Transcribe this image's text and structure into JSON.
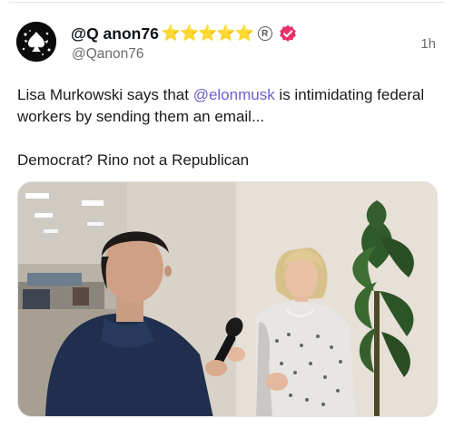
{
  "post": {
    "display_name": "@Q anon76",
    "name_decoration": "⭐⭐⭐⭐⭐",
    "registered_mark": "R",
    "handle": "@Qanon76",
    "timestamp": "1h",
    "text": {
      "line1_before": "Lisa Murkowski says that ",
      "mention": "@elonmusk",
      "line1_after": " is intimidating federal workers by sending them an email...",
      "line2": "Democrat? Rino not a Republican"
    },
    "media": {
      "icon": "video-thumbnail"
    }
  },
  "icons": {
    "avatar": "spade-splash-avatar-icon",
    "verified": "verified-badge-icon"
  },
  "colors": {
    "mention": "#6a5fcf",
    "verified": "#e8326a",
    "stars": "#f7c325",
    "secondary_text": "#6b6b6b"
  }
}
